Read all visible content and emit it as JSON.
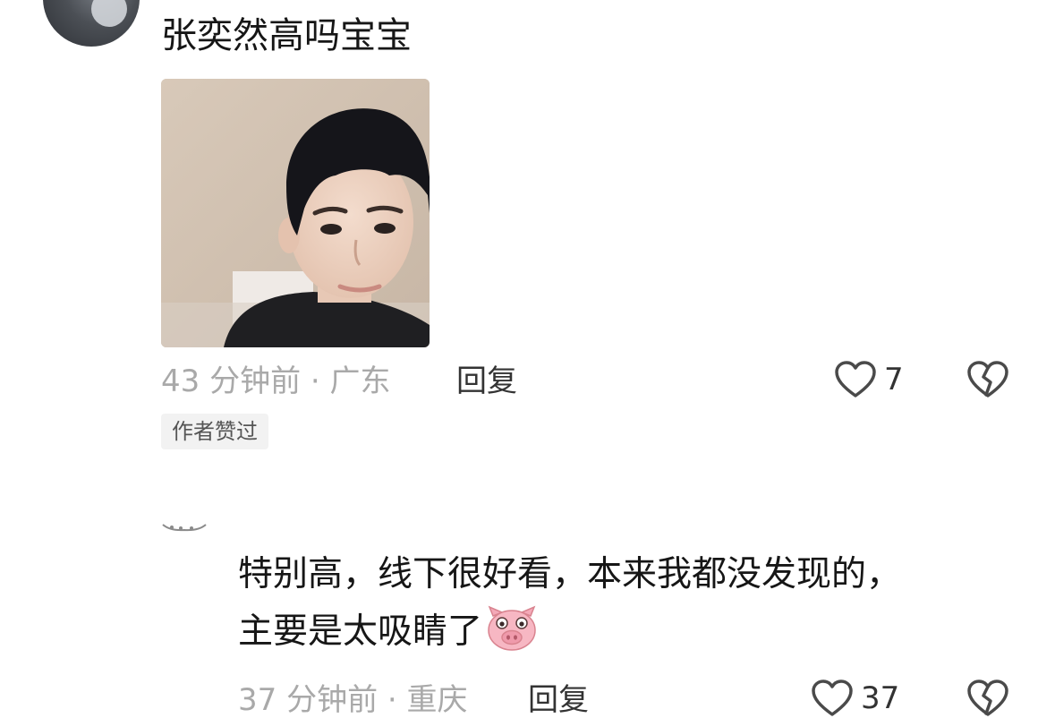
{
  "comments": [
    {
      "text": "张奕然高吗宝宝",
      "image_alt": "boy-portrait-photo",
      "time": "43 分钟前 · 广东",
      "reply_label": "回复",
      "likes": "7",
      "badge": "作者赞过"
    },
    {
      "text_line1": "特别高，线下很好看，本来我都没发现的，",
      "text_line2": "主要是太吸睛了",
      "emoji": "pig-face-emoji",
      "time": "37 分钟前 · 重庆",
      "reply_label": "回复",
      "likes": "37"
    }
  ],
  "icons": {
    "like": "heart-outline-icon",
    "dislike": "broken-heart-icon"
  },
  "colors": {
    "text": "#161616",
    "meta": "#a9a9a9",
    "icon": "#4a4a4a",
    "badge_bg": "#f2f2f2",
    "emoji_pink": "#f7b7c3"
  }
}
